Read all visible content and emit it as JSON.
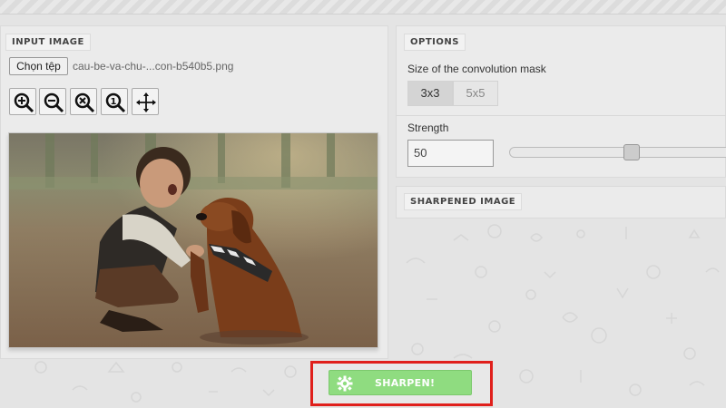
{
  "input_panel": {
    "title": "INPUT IMAGE",
    "file_button_label": "Chọn tệp",
    "file_name": "cau-be-va-chu-...con-b540b5.png",
    "tools": [
      "zoom-in",
      "zoom-out",
      "zoom-reset",
      "zoom-fit",
      "move"
    ]
  },
  "options_panel": {
    "title": "OPTIONS",
    "mask_label": "Size of the convolution mask",
    "mask_options": [
      "3x3",
      "5x5"
    ],
    "mask_selected": "3x3",
    "strength_label": "Strength",
    "strength_value": "50",
    "strength_level_fraction": 0.55
  },
  "sharpened_panel": {
    "title": "SHARPENED IMAGE"
  },
  "action": {
    "sharpen_label": "SHARPEN!",
    "sharpen_color": "#8fdc80",
    "highlight_color": "#e0201c"
  }
}
